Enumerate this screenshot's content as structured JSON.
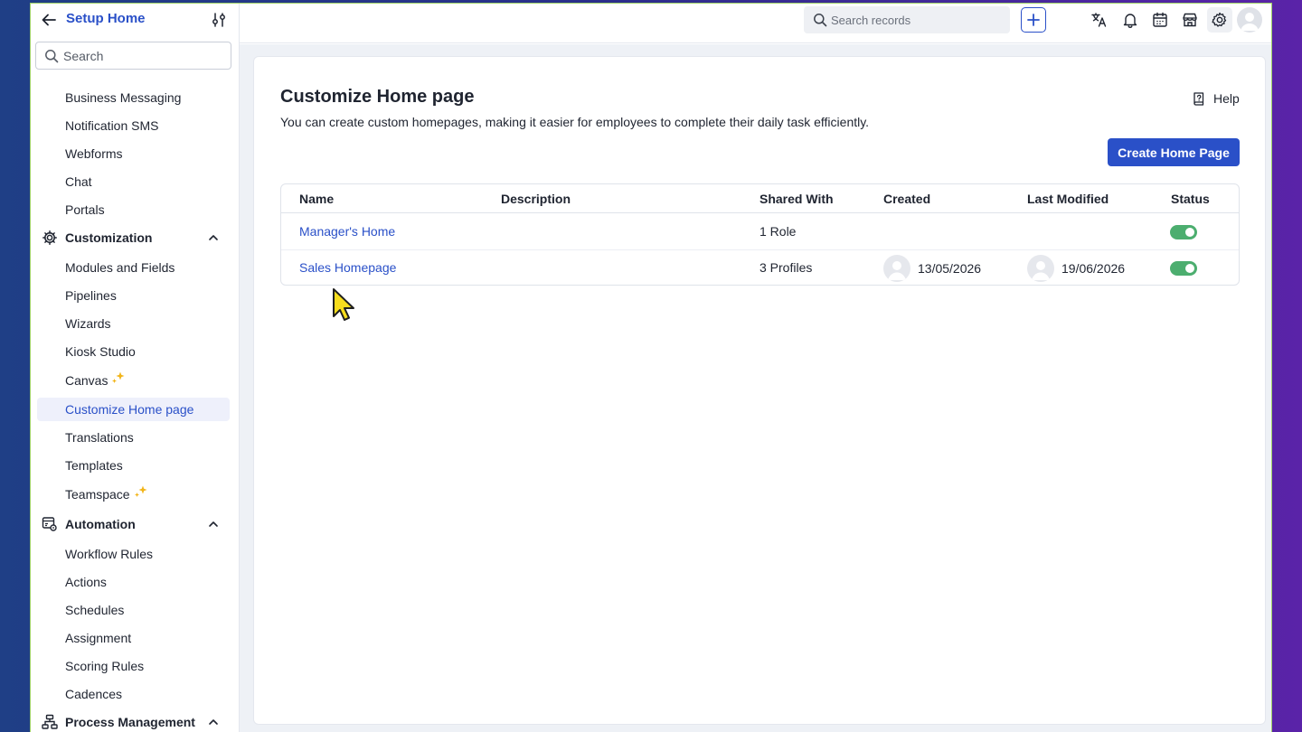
{
  "sidebar": {
    "title": "Setup Home",
    "search_placeholder": "Search",
    "items_top": [
      "Business Messaging",
      "Notification SMS",
      "Webforms",
      "Chat",
      "Portals"
    ],
    "customization": {
      "label": "Customization",
      "items": [
        "Modules and Fields",
        "Pipelines",
        "Wizards",
        "Kiosk Studio",
        "Canvas",
        "Customize Home page",
        "Translations",
        "Templates",
        "Teamspace"
      ]
    },
    "automation": {
      "label": "Automation",
      "items": [
        "Workflow Rules",
        "Actions",
        "Schedules",
        "Assignment",
        "Scoring Rules",
        "Cadences"
      ]
    },
    "process_management": {
      "label": "Process Management"
    }
  },
  "topbar": {
    "search_placeholder": "Search records"
  },
  "main": {
    "title": "Customize Home page",
    "description": "You can create custom homepages, making it easier for employees to complete their daily task efficiently.",
    "help_label": "Help",
    "create_button": "Create Home Page",
    "table": {
      "columns": [
        "Name",
        "Description",
        "Shared With",
        "Created",
        "Last Modified",
        "Status"
      ],
      "rows": [
        {
          "name": "Manager's Home",
          "description": "",
          "shared_with": "1 Role",
          "created": "",
          "last_modified": "",
          "status": "on"
        },
        {
          "name": "Sales Homepage",
          "description": "",
          "shared_with": "3 Profiles",
          "created": "13/05/2026",
          "last_modified": "19/06/2026",
          "status": "on"
        }
      ]
    }
  },
  "colors": {
    "accent": "#2a50c8",
    "toggle_on": "#4cae6f",
    "active_bg": "#eef0fb"
  }
}
